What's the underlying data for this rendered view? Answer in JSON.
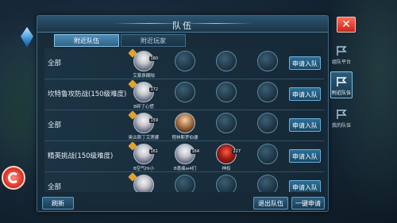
{
  "window": {
    "title": "队伍"
  },
  "tabs": [
    {
      "label": "附近队伍",
      "active": true
    },
    {
      "label": "附近玩家",
      "active": false
    }
  ],
  "rows": [
    {
      "name": "全部",
      "members": [
        {
          "name": "艾慕泉糊咖",
          "level": "160",
          "type": "avatar"
        }
      ],
      "apply": "申请入队"
    },
    {
      "name": "坎特鲁攻防战(150级难度)",
      "members": [
        {
          "name": "B碎了心慌",
          "level": "172",
          "type": "avatar"
        }
      ],
      "apply": "申请入队"
    },
    {
      "name": "全部",
      "members": [
        {
          "name": "奥古斯丁艾莲娜",
          "level": "159",
          "type": "avatar"
        },
        {
          "name": "程林斯罗伯德",
          "level": "",
          "type": "brown"
        }
      ],
      "apply": "申请入队"
    },
    {
      "name": "精英挑战(150级难度)",
      "members": [
        {
          "name": "B空气Hi小",
          "level": "161",
          "type": "avatar"
        },
        {
          "name": "B愚痛w4们",
          "level": "164",
          "type": "avatar"
        },
        {
          "name": "神权",
          "level": "227",
          "type": "red"
        }
      ],
      "apply": "申请入队"
    },
    {
      "name": "全部",
      "members": [
        {
          "name": "",
          "level": "",
          "type": "avatar"
        }
      ],
      "apply": "申请入队"
    }
  ],
  "buttons": {
    "refresh": "刷新",
    "leave": "退出队伍",
    "quick_apply": "一键申请",
    "close": "✕"
  },
  "side_menu": [
    {
      "label": "组队平台",
      "active": false
    },
    {
      "label": "附近队伍",
      "active": true
    },
    {
      "label": "我的队伍",
      "active": false
    }
  ]
}
